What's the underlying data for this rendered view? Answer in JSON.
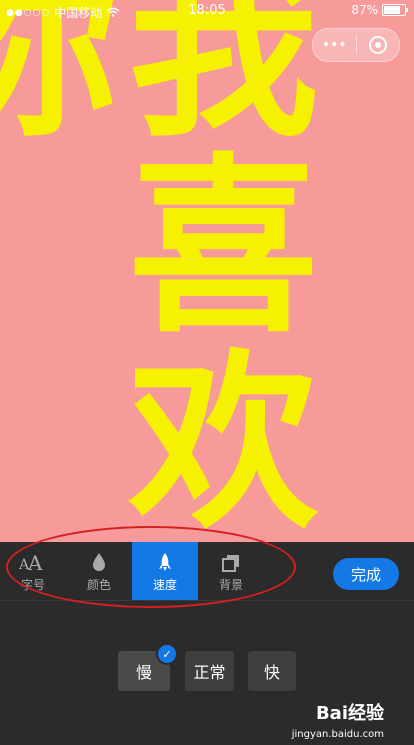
{
  "status_bar": {
    "carrier_dots": "●●○○○",
    "carrier": "中国移动",
    "time": "18:05",
    "battery": "87%"
  },
  "capsule": {
    "more_label": "•••"
  },
  "preview": {
    "text": "我喜欢你"
  },
  "toolbar": {
    "tools": [
      {
        "label": "字号",
        "icon": "font-size-icon"
      },
      {
        "label": "颜色",
        "icon": "droplet-icon"
      },
      {
        "label": "速度",
        "icon": "rocket-icon",
        "active": true
      },
      {
        "label": "背景",
        "icon": "layers-icon"
      }
    ],
    "done_label": "完成"
  },
  "speed_options": {
    "slow": "慢",
    "normal": "正常",
    "fast": "快",
    "selected": "慢"
  },
  "watermark": {
    "brand": "Bai经验",
    "url": "jingyan.baidu.com"
  },
  "colors": {
    "accent": "#1478e6",
    "preview_bg": "#f79a9a",
    "preview_text": "#f6f100",
    "annotation": "#d42020"
  }
}
